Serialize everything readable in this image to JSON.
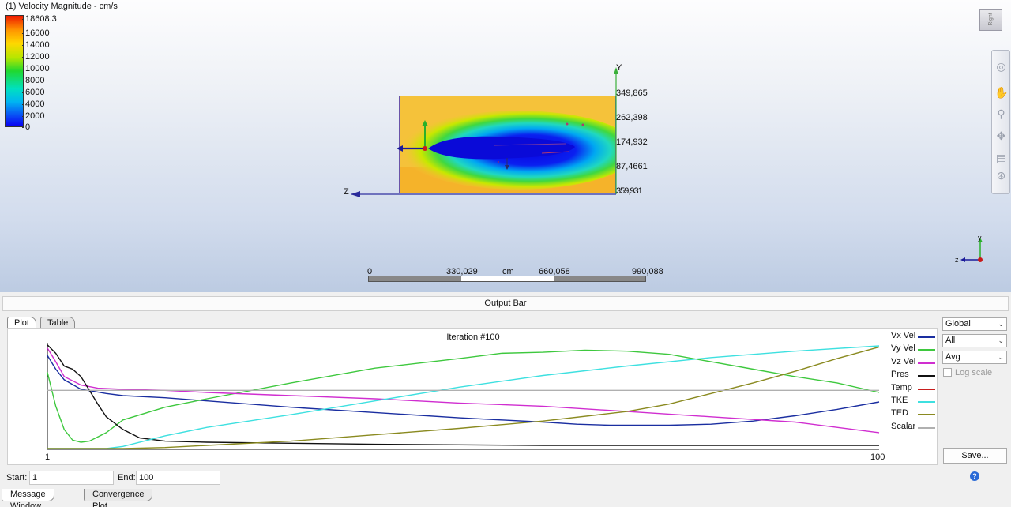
{
  "viewport": {
    "title": "(1) Velocity Magnitude - cm/s",
    "legend": [
      "18608.3",
      "16000",
      "14000",
      "12000",
      "10000",
      "8000",
      "6000",
      "4000",
      "2000",
      "0"
    ],
    "y_ticks": [
      "349,865",
      "262,398",
      "174,932",
      "87,4661",
      "359,931"
    ],
    "axis_y": "Y",
    "axis_z": "Z",
    "scale": {
      "labels": [
        "0",
        "330,029",
        "cm",
        "660,058",
        "990,088"
      ]
    },
    "triad": {
      "y": "y",
      "z": "z"
    },
    "viewcube_label": "Right",
    "nav_icons": [
      "steering-wheel-icon",
      "pan-hand-icon",
      "zoom-icon",
      "orbit-icon",
      "look-icon",
      "walk-icon"
    ]
  },
  "output": {
    "title": "Output Bar",
    "tabs": [
      "Plot",
      "Table"
    ],
    "plot_title": "Iteration #100",
    "dropdowns": [
      "Global",
      "All",
      "Avg"
    ],
    "log_scale": "Log scale",
    "save": "Save...",
    "start_label": "Start:",
    "start_value": "1",
    "end_label": "End:",
    "end_value": "100",
    "bottom_tabs": [
      "Message Window",
      "Convergence Plot"
    ]
  },
  "chart_data": {
    "type": "line",
    "title": "Iteration #100",
    "xlim": [
      1,
      100
    ],
    "x_ticks": [
      "1",
      "100"
    ],
    "y_ticks": [],
    "legend_position": "right",
    "series": [
      {
        "name": "Vx Vel",
        "color": "#1a2ea0",
        "x": [
          1,
          2,
          3,
          5,
          8,
          10,
          15,
          20,
          30,
          40,
          50,
          55,
          60,
          64,
          68,
          70,
          75,
          80,
          85,
          90,
          95,
          100
        ],
        "y": [
          0.88,
          0.75,
          0.65,
          0.56,
          0.52,
          0.5,
          0.48,
          0.45,
          0.39,
          0.34,
          0.29,
          0.27,
          0.25,
          0.23,
          0.22,
          0.22,
          0.22,
          0.23,
          0.26,
          0.31,
          0.37,
          0.44
        ]
      },
      {
        "name": "Vy Vel",
        "color": "#3ec83e",
        "x": [
          1,
          2,
          3,
          4,
          5,
          6,
          8,
          10,
          15,
          20,
          30,
          40,
          50,
          55,
          60,
          65,
          70,
          75,
          80,
          85,
          90,
          95,
          100
        ],
        "y": [
          0.72,
          0.4,
          0.18,
          0.08,
          0.06,
          0.07,
          0.15,
          0.27,
          0.39,
          0.47,
          0.62,
          0.76,
          0.85,
          0.9,
          0.91,
          0.93,
          0.92,
          0.89,
          0.82,
          0.75,
          0.68,
          0.62,
          0.53
        ]
      },
      {
        "name": "Vz Vel",
        "color": "#d02ed0",
        "x": [
          1,
          2,
          3,
          5,
          7,
          10,
          15,
          20,
          30,
          40,
          50,
          60,
          70,
          80,
          90,
          100
        ],
        "y": [
          0.95,
          0.82,
          0.68,
          0.6,
          0.57,
          0.56,
          0.55,
          0.53,
          0.5,
          0.47,
          0.43,
          0.4,
          0.35,
          0.3,
          0.25,
          0.15
        ]
      },
      {
        "name": "Pres",
        "color": "#111111",
        "x": [
          1,
          2,
          3,
          4,
          5,
          6,
          7,
          8,
          10,
          12,
          15,
          20,
          30,
          40,
          50,
          60,
          70,
          80,
          90,
          100
        ],
        "y": [
          0.98,
          0.9,
          0.78,
          0.75,
          0.68,
          0.55,
          0.42,
          0.3,
          0.18,
          0.1,
          0.07,
          0.06,
          0.05,
          0.04,
          0.035,
          0.03,
          0.03,
          0.03,
          0.03,
          0.03
        ]
      },
      {
        "name": "Temp",
        "color": "#c81e1e",
        "x": [],
        "y": []
      },
      {
        "name": "TKE",
        "color": "#3ee0e0",
        "x": [
          1,
          5,
          8,
          10,
          15,
          20,
          30,
          40,
          50,
          60,
          70,
          80,
          90,
          100
        ],
        "y": [
          0.0,
          0.0,
          0.0,
          0.02,
          0.12,
          0.2,
          0.32,
          0.45,
          0.58,
          0.69,
          0.78,
          0.86,
          0.92,
          0.97
        ]
      },
      {
        "name": "TED",
        "color": "#8a8a20",
        "x": [
          1,
          10,
          15,
          20,
          30,
          40,
          50,
          60,
          70,
          75,
          80,
          85,
          90,
          95,
          100
        ],
        "y": [
          0.0,
          0.0,
          0.01,
          0.03,
          0.07,
          0.13,
          0.19,
          0.26,
          0.35,
          0.42,
          0.52,
          0.62,
          0.73,
          0.85,
          0.96
        ]
      },
      {
        "name": "Scalar",
        "color": "#b0b0b0",
        "x": [
          1,
          100
        ],
        "y": [
          0.55,
          0.55
        ]
      }
    ]
  }
}
